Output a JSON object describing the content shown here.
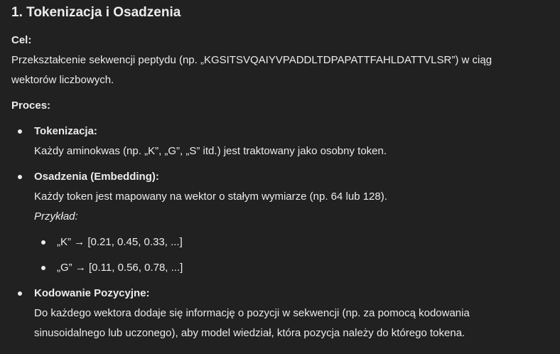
{
  "heading": "1. Tokenizacja i Osadzenia",
  "goal": {
    "label": "Cel:",
    "line1": "Przekształcenie sekwencji peptydu (np. „KGSITSVQAIYVPADDLTDPAPATTFAHLDATTVLSR”) w ciąg",
    "line2": "wektorów liczbowych."
  },
  "process": {
    "label": "Proces:",
    "items": [
      {
        "title": "Tokenizacja:",
        "lines": [
          "Każdy aminokwas (np. „K”, „G”, „S” itd.) jest traktowany jako osobny token."
        ]
      },
      {
        "title": "Osadzenia (Embedding):",
        "lines": [
          "Każdy token jest mapowany na wektor o stałym wymiarze (np. 64 lub 128)."
        ],
        "example_label": "Przykład:",
        "examples": [
          "„K” → [0.21, 0.45, 0.33, ...]",
          "„G” → [0.11, 0.56, 0.78, ...]"
        ]
      },
      {
        "title": "Kodowanie Pozycyjne:",
        "lines": [
          "Do każdego wektora dodaje się informację o pozycji w sekwencji (np. za pomocą kodowania",
          "sinusoidalnego lub uczonego), aby model wiedział, która pozycja należy do którego tokena."
        ]
      }
    ]
  }
}
